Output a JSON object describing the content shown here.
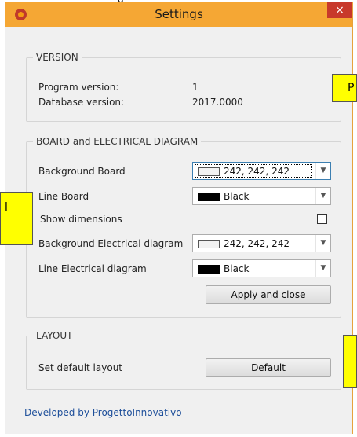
{
  "window": {
    "title": "Settings",
    "close_glyph": "×",
    "top_strip_text": "g"
  },
  "version": {
    "legend": "VERSION",
    "program_label": "Program version:",
    "program_value": "1",
    "database_label": "Database version:",
    "database_value": "2017.0000"
  },
  "board": {
    "legend": "BOARD and ELECTRICAL DIAGRAM",
    "background_board_label": "Background Board",
    "background_board_value": "242, 242, 242",
    "line_board_label": "Line Board",
    "line_board_value": "Black",
    "show_dimensions_label": "Show dimensions",
    "show_dimensions_checked": false,
    "background_electrical_label": "Background Electrical diagram",
    "background_electrical_value": "242, 242, 242",
    "line_electrical_label": "Line Electrical diagram",
    "line_electrical_value": "Black",
    "apply_close_label": "Apply and close"
  },
  "layout": {
    "legend": "LAYOUT",
    "set_default_label": "Set default layout",
    "default_button_label": "Default"
  },
  "footer": {
    "text": "Developed by ProgettoInnovativo"
  },
  "overlays": {
    "right_top_text": "P",
    "left_mid_text": "l"
  },
  "colors": {
    "titlebar": "#f5a734",
    "close": "#c8392b",
    "overlay": "#ffff00",
    "light_swatch": "#f2f2f2",
    "dark_swatch": "#000000",
    "footer_link": "#1e4f9a"
  },
  "icons": {
    "app": "app-logo-icon",
    "close": "close-icon",
    "dropdown": "chevron-down-icon"
  }
}
